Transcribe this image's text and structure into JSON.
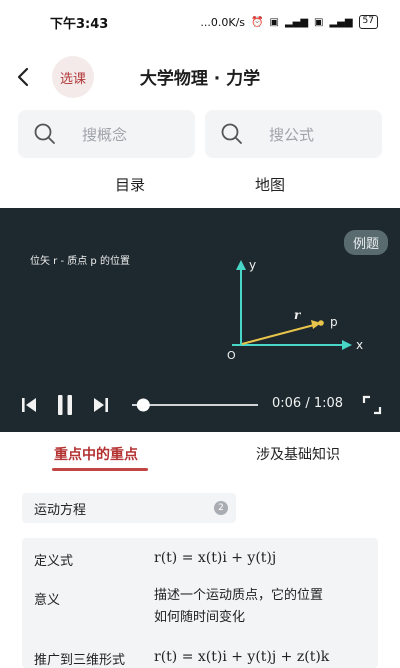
{
  "status_bar": {
    "time": "下午3:43",
    "network_speed": "...0.0K/s",
    "battery": "57"
  },
  "app_bar": {
    "select_course_label": "选课",
    "title": "大学物理 · 力学"
  },
  "search": {
    "concept_placeholder": "搜概念",
    "formula_placeholder": "搜公式"
  },
  "toc": {
    "catalog_label": "目录",
    "map_label": "地图"
  },
  "video": {
    "example_badge": "例题",
    "caption": "位矢 r - 质点 p 的位置",
    "axis_y": "y",
    "axis_x": "x",
    "origin": "O",
    "vector_label": "r",
    "point_label": "p",
    "current_time": "0:06",
    "duration": "1:08",
    "progress": 0.09
  },
  "tabs": {
    "key_points": "重点中的重点",
    "basics": "涉及基础知识"
  },
  "section": {
    "title": "运动方程",
    "count": "2"
  },
  "table": {
    "rows": [
      {
        "label": "定义式",
        "value": "r(t) = x(t)i + y(t)j"
      },
      {
        "label": "意义",
        "value_line1": "描述一个运动质点，它的位置",
        "value_line2": "如何随时间变化"
      },
      {
        "label": "推广到三维形式",
        "value": "r(t) = x(t)i + y(t)j + z(t)k"
      }
    ]
  },
  "colors": {
    "accent": "#b43333",
    "video_bg": "#1d292e",
    "axis": "#48d6c6",
    "vector": "#e8c44a"
  }
}
